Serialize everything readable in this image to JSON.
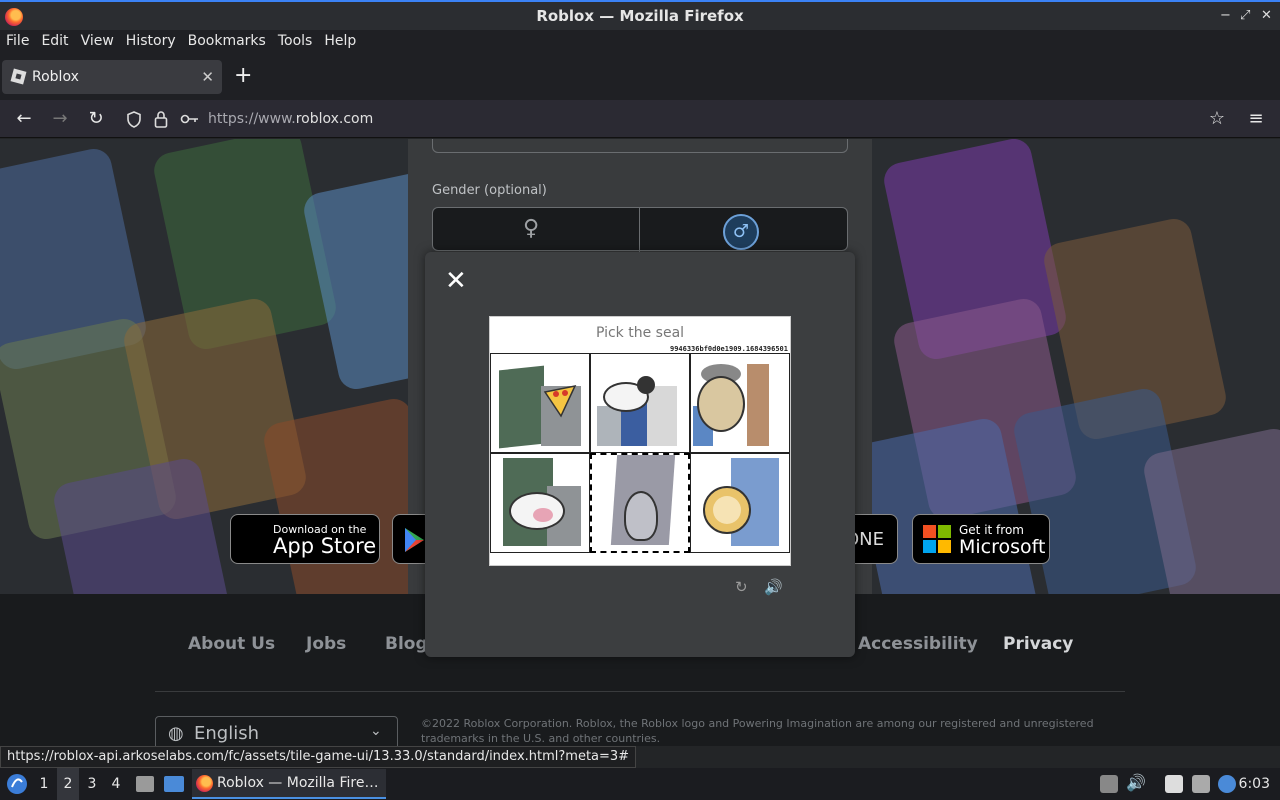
{
  "window": {
    "title": "Roblox — Mozilla Firefox",
    "controls": [
      "−",
      "⤢",
      "✕"
    ]
  },
  "menu": [
    "File",
    "Edit",
    "View",
    "History",
    "Bookmarks",
    "Tools",
    "Help"
  ],
  "tab": {
    "label": "Roblox",
    "close": "✕",
    "new_tab": "+"
  },
  "nav": {
    "back": "←",
    "forward": "→",
    "reload": "↻",
    "url_prefix": "https://www.",
    "url_domain": "roblox.com",
    "star": "☆",
    "menu": "≡"
  },
  "signup": {
    "gender_label": "Gender (optional)"
  },
  "stores": {
    "appstore_small": "Download on the",
    "appstore_big": "App Store",
    "xbox_text": "ONE",
    "ms_small": "Get it from",
    "ms_big": "Microsoft"
  },
  "footer": {
    "links": [
      "About Us",
      "Jobs",
      "Blog",
      "Accessibility",
      "Privacy"
    ],
    "language": "English",
    "copyright": "©2022 Roblox Corporation. Roblox, the Roblox logo and Powering Imagination are among our registered and unregistered trademarks in the U.S. and other countries."
  },
  "captcha": {
    "close": "✕",
    "prompt": "Pick the seal",
    "hash": "9946336bf0d0e1909.1684396501",
    "tiles": [
      "pizza",
      "sheep",
      "lion",
      "cow",
      "seal",
      "lion"
    ],
    "selected_index": 4,
    "reload_icon": "↻",
    "audio_icon": "🔊"
  },
  "status_url": "https://roblox-api.arkoselabs.com/fc/assets/tile-game-ui/13.33.0/standard/index.html?meta=3#",
  "taskbar": {
    "workspaces": [
      "1",
      "2",
      "3",
      "4"
    ],
    "active_workspace": "2",
    "app_label": "Roblox — Mozilla Fire…",
    "clock": "6:03"
  }
}
